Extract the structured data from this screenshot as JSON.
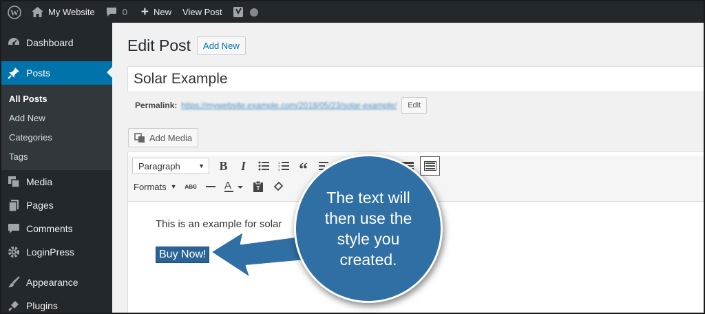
{
  "admin_bar": {
    "site_name": "My Website",
    "comments_count": "0",
    "new_label": "New",
    "view_post_label": "View Post"
  },
  "sidebar": {
    "items": [
      {
        "label": "Dashboard",
        "icon": "dashboard-icon"
      },
      {
        "label": "Posts",
        "icon": "pin-icon",
        "active": true
      },
      {
        "label": "Media",
        "icon": "media-icon"
      },
      {
        "label": "Pages",
        "icon": "pages-icon"
      },
      {
        "label": "Comments",
        "icon": "comment-icon"
      },
      {
        "label": "LoginPress",
        "icon": "gear-icon"
      },
      {
        "label": "Appearance",
        "icon": "brush-icon"
      },
      {
        "label": "Plugins",
        "icon": "plug-icon"
      }
    ],
    "submenu": [
      "All Posts",
      "Add New",
      "Categories",
      "Tags"
    ]
  },
  "main": {
    "page_title": "Edit Post",
    "add_new_label": "Add New",
    "post_title": "Solar Example",
    "permalink_label": "Permalink:",
    "permalink_url": "https://mywebsite.example.com/2018/05/23/solar-example/",
    "edit_label": "Edit",
    "add_media_label": "Add Media"
  },
  "editor": {
    "format_select": "Paragraph",
    "formats_label": "Formats",
    "strike_label": "ABC",
    "paragraph_text": "This is an example for solar",
    "button_text": "Buy Now!"
  },
  "callout": {
    "text": "The text will then use the style you created."
  },
  "colors": {
    "admin_bar": "#23282d",
    "accent": "#0073aa",
    "callout": "#2f6fa3",
    "buy_now_bg": "#2a6496"
  }
}
